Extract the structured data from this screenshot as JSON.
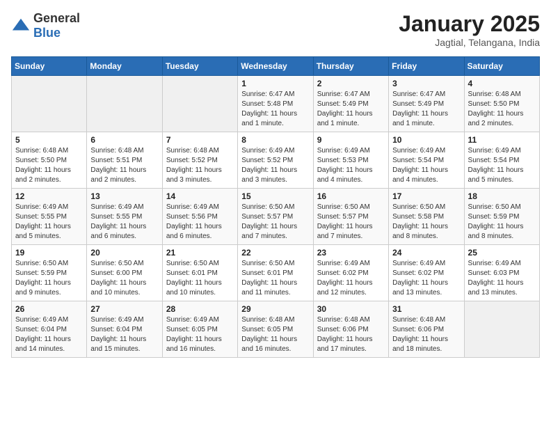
{
  "header": {
    "logo_general": "General",
    "logo_blue": "Blue",
    "title": "January 2025",
    "location": "Jagtial, Telangana, India"
  },
  "days_of_week": [
    "Sunday",
    "Monday",
    "Tuesday",
    "Wednesday",
    "Thursday",
    "Friday",
    "Saturday"
  ],
  "weeks": [
    [
      {
        "day": "",
        "info": ""
      },
      {
        "day": "",
        "info": ""
      },
      {
        "day": "",
        "info": ""
      },
      {
        "day": "1",
        "info": "Sunrise: 6:47 AM\nSunset: 5:48 PM\nDaylight: 11 hours and 1 minute."
      },
      {
        "day": "2",
        "info": "Sunrise: 6:47 AM\nSunset: 5:49 PM\nDaylight: 11 hours and 1 minute."
      },
      {
        "day": "3",
        "info": "Sunrise: 6:47 AM\nSunset: 5:49 PM\nDaylight: 11 hours and 1 minute."
      },
      {
        "day": "4",
        "info": "Sunrise: 6:48 AM\nSunset: 5:50 PM\nDaylight: 11 hours and 2 minutes."
      }
    ],
    [
      {
        "day": "5",
        "info": "Sunrise: 6:48 AM\nSunset: 5:50 PM\nDaylight: 11 hours and 2 minutes."
      },
      {
        "day": "6",
        "info": "Sunrise: 6:48 AM\nSunset: 5:51 PM\nDaylight: 11 hours and 2 minutes."
      },
      {
        "day": "7",
        "info": "Sunrise: 6:48 AM\nSunset: 5:52 PM\nDaylight: 11 hours and 3 minutes."
      },
      {
        "day": "8",
        "info": "Sunrise: 6:49 AM\nSunset: 5:52 PM\nDaylight: 11 hours and 3 minutes."
      },
      {
        "day": "9",
        "info": "Sunrise: 6:49 AM\nSunset: 5:53 PM\nDaylight: 11 hours and 4 minutes."
      },
      {
        "day": "10",
        "info": "Sunrise: 6:49 AM\nSunset: 5:54 PM\nDaylight: 11 hours and 4 minutes."
      },
      {
        "day": "11",
        "info": "Sunrise: 6:49 AM\nSunset: 5:54 PM\nDaylight: 11 hours and 5 minutes."
      }
    ],
    [
      {
        "day": "12",
        "info": "Sunrise: 6:49 AM\nSunset: 5:55 PM\nDaylight: 11 hours and 5 minutes."
      },
      {
        "day": "13",
        "info": "Sunrise: 6:49 AM\nSunset: 5:55 PM\nDaylight: 11 hours and 6 minutes."
      },
      {
        "day": "14",
        "info": "Sunrise: 6:49 AM\nSunset: 5:56 PM\nDaylight: 11 hours and 6 minutes."
      },
      {
        "day": "15",
        "info": "Sunrise: 6:50 AM\nSunset: 5:57 PM\nDaylight: 11 hours and 7 minutes."
      },
      {
        "day": "16",
        "info": "Sunrise: 6:50 AM\nSunset: 5:57 PM\nDaylight: 11 hours and 7 minutes."
      },
      {
        "day": "17",
        "info": "Sunrise: 6:50 AM\nSunset: 5:58 PM\nDaylight: 11 hours and 8 minutes."
      },
      {
        "day": "18",
        "info": "Sunrise: 6:50 AM\nSunset: 5:59 PM\nDaylight: 11 hours and 8 minutes."
      }
    ],
    [
      {
        "day": "19",
        "info": "Sunrise: 6:50 AM\nSunset: 5:59 PM\nDaylight: 11 hours and 9 minutes."
      },
      {
        "day": "20",
        "info": "Sunrise: 6:50 AM\nSunset: 6:00 PM\nDaylight: 11 hours and 10 minutes."
      },
      {
        "day": "21",
        "info": "Sunrise: 6:50 AM\nSunset: 6:01 PM\nDaylight: 11 hours and 10 minutes."
      },
      {
        "day": "22",
        "info": "Sunrise: 6:50 AM\nSunset: 6:01 PM\nDaylight: 11 hours and 11 minutes."
      },
      {
        "day": "23",
        "info": "Sunrise: 6:49 AM\nSunset: 6:02 PM\nDaylight: 11 hours and 12 minutes."
      },
      {
        "day": "24",
        "info": "Sunrise: 6:49 AM\nSunset: 6:02 PM\nDaylight: 11 hours and 13 minutes."
      },
      {
        "day": "25",
        "info": "Sunrise: 6:49 AM\nSunset: 6:03 PM\nDaylight: 11 hours and 13 minutes."
      }
    ],
    [
      {
        "day": "26",
        "info": "Sunrise: 6:49 AM\nSunset: 6:04 PM\nDaylight: 11 hours and 14 minutes."
      },
      {
        "day": "27",
        "info": "Sunrise: 6:49 AM\nSunset: 6:04 PM\nDaylight: 11 hours and 15 minutes."
      },
      {
        "day": "28",
        "info": "Sunrise: 6:49 AM\nSunset: 6:05 PM\nDaylight: 11 hours and 16 minutes."
      },
      {
        "day": "29",
        "info": "Sunrise: 6:48 AM\nSunset: 6:05 PM\nDaylight: 11 hours and 16 minutes."
      },
      {
        "day": "30",
        "info": "Sunrise: 6:48 AM\nSunset: 6:06 PM\nDaylight: 11 hours and 17 minutes."
      },
      {
        "day": "31",
        "info": "Sunrise: 6:48 AM\nSunset: 6:06 PM\nDaylight: 11 hours and 18 minutes."
      },
      {
        "day": "",
        "info": ""
      }
    ]
  ]
}
